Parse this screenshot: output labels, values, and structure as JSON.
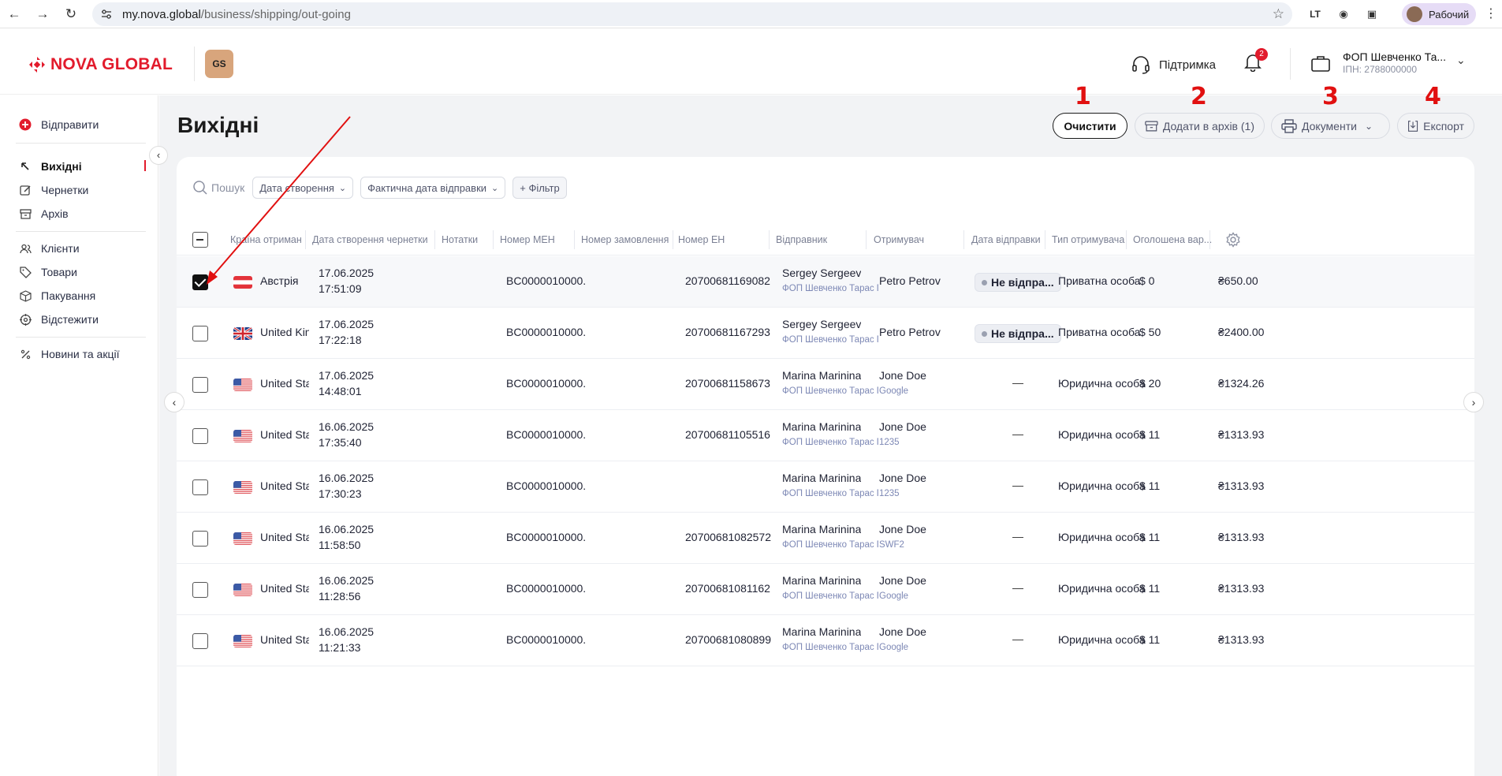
{
  "browser": {
    "url_host": "my.nova.global",
    "url_path": "/business/shipping/out-going",
    "profile_label": "Рабочий",
    "icons": [
      "back-icon",
      "forward-icon",
      "reload-icon",
      "site-settings-icon",
      "star-icon",
      "extension-icon",
      "camera-icon",
      "puzzle-icon",
      "menu-icon"
    ]
  },
  "header": {
    "logo_text": "NOVA GLOBAL",
    "gs_badge": "GS",
    "support_label": "Підтримка",
    "notifications_count": "2",
    "account_name": "ФОП Шевченко Та...",
    "account_ipn": "ІПН: 2788000000",
    "brand_color": "#e21b2c"
  },
  "sidebar": {
    "send_label": "Відправити",
    "items": [
      {
        "label": "Вихідні",
        "icon": "arrow-up-left-icon"
      },
      {
        "label": "Чернетки",
        "icon": "edit-icon"
      },
      {
        "label": "Архів",
        "icon": "archive-icon"
      },
      {
        "label": "Клієнти",
        "icon": "users-icon"
      },
      {
        "label": "Товари",
        "icon": "tag-icon"
      },
      {
        "label": "Пакування",
        "icon": "box-icon"
      },
      {
        "label": "Відстежити",
        "icon": "track-icon"
      },
      {
        "label": "Новини та акції",
        "icon": "percent-icon"
      }
    ]
  },
  "page": {
    "title": "Вихідні",
    "actions": {
      "clear": "Очистити",
      "archive": "Додати в архів (1)",
      "documents": "Документи",
      "export": "Експорт"
    },
    "annotations": [
      "1",
      "2",
      "3",
      "4"
    ]
  },
  "filters": {
    "search_placeholder": "Пошук",
    "created_date": "Дата створення",
    "actual_date": "Фактична дата відправки",
    "add_filter": "+ Фільтр"
  },
  "table": {
    "columns": [
      "Країна отримання",
      "Дата створення чернетки",
      "Нотатки",
      "Номер МЕН",
      "Номер замовлення",
      "Номер ЕН",
      "Відправник",
      "Отримувач",
      "Дата відправки",
      "Тип отримувача",
      "Оголошена вар..."
    ],
    "rows": [
      {
        "checked": true,
        "flag": "at",
        "country": "Австрія",
        "date": "17.06.2025",
        "time": "17:51:09",
        "men": "BC0000010000...",
        "en": "20700681169082",
        "sender": "Sergey Sergeev",
        "sender_sub": "ФОП Шевченко Тарас Г...",
        "recipient": "Petro Petrov",
        "recipient_sub": "",
        "ship_date": "Не відпра...",
        "type": "Приватна особа",
        "declared": "$ 0",
        "amount": "₴650.00"
      },
      {
        "checked": false,
        "flag": "gb",
        "country": "United Kin...",
        "date": "17.06.2025",
        "time": "17:22:18",
        "men": "BC0000010000...",
        "en": "20700681167293",
        "sender": "Sergey Sergeev",
        "sender_sub": "ФОП Шевченко Тарас Г...",
        "recipient": "Petro Petrov",
        "recipient_sub": "",
        "ship_date": "Не відпра...",
        "type": "Приватна особа",
        "declared": "$ 50",
        "amount": "₴2400.00"
      },
      {
        "checked": false,
        "flag": "us",
        "country": "United Stat...",
        "date": "17.06.2025",
        "time": "14:48:01",
        "men": "BC0000010000...",
        "en": "20700681158673",
        "sender": "Marina Marinina",
        "sender_sub": "ФОП Шевченко Тарас Г...",
        "recipient": "Jone Doe",
        "recipient_sub": "Google",
        "ship_date": "—",
        "type": "Юридична особа",
        "declared": "$ 20",
        "amount": "₴1324.26"
      },
      {
        "checked": false,
        "flag": "us",
        "country": "United Stat...",
        "date": "16.06.2025",
        "time": "17:35:40",
        "men": "BC0000010000...",
        "en": "20700681105516",
        "sender": "Marina Marinina",
        "sender_sub": "ФОП Шевченко Тарас Г...",
        "recipient": "Jone Doe",
        "recipient_sub": "1235",
        "ship_date": "—",
        "type": "Юридична особа",
        "declared": "$ 11",
        "amount": "₴1313.93"
      },
      {
        "checked": false,
        "flag": "us",
        "country": "United Stat...",
        "date": "16.06.2025",
        "time": "17:30:23",
        "men": "BC0000010000...",
        "en": "",
        "sender": "Marina Marinina",
        "sender_sub": "ФОП Шевченко Тарас Г...",
        "recipient": "Jone Doe",
        "recipient_sub": "1235",
        "ship_date": "—",
        "type": "Юридична особа",
        "declared": "$ 11",
        "amount": "₴1313.93"
      },
      {
        "checked": false,
        "flag": "us",
        "country": "United Stat...",
        "date": "16.06.2025",
        "time": "11:58:50",
        "men": "BC0000010000...",
        "en": "20700681082572",
        "sender": "Marina Marinina",
        "sender_sub": "ФОП Шевченко Тарас Г...",
        "recipient": "Jone Doe",
        "recipient_sub": "SWF2",
        "ship_date": "—",
        "type": "Юридична особа",
        "declared": "$ 11",
        "amount": "₴1313.93"
      },
      {
        "checked": false,
        "flag": "us",
        "country": "United Stat...",
        "date": "16.06.2025",
        "time": "11:28:56",
        "men": "BC0000010000...",
        "en": "20700681081162",
        "sender": "Marina Marinina",
        "sender_sub": "ФОП Шевченко Тарас Г...",
        "recipient": "Jone Doe",
        "recipient_sub": "Google",
        "ship_date": "—",
        "type": "Юридична особа",
        "declared": "$ 11",
        "amount": "₴1313.93"
      },
      {
        "checked": false,
        "flag": "us",
        "country": "United Stat...",
        "date": "16.06.2025",
        "time": "11:21:33",
        "men": "BC0000010000...",
        "en": "20700681080899",
        "sender": "Marina Marinina",
        "sender_sub": "ФОП Шевченко Тарас Г...",
        "recipient": "Jone Doe",
        "recipient_sub": "Google",
        "ship_date": "—",
        "type": "Юридична особа",
        "declared": "$ 11",
        "amount": "₴1313.93"
      }
    ]
  }
}
